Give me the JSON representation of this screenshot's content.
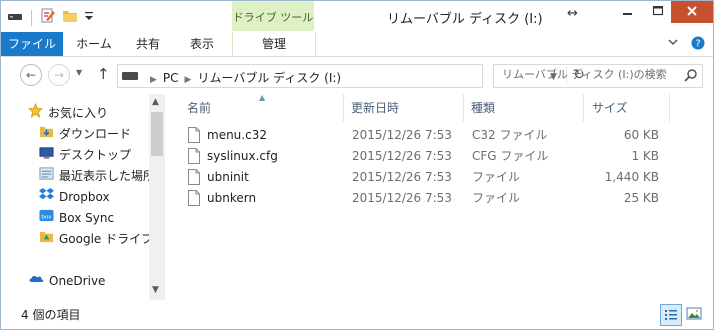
{
  "window": {
    "title": "リムーバブル ディスク (I:)",
    "context_tab": "ドライブ ツール"
  },
  "ribbon": {
    "tabs": [
      "ファイル",
      "ホーム",
      "共有",
      "表示",
      "管理"
    ]
  },
  "address": {
    "crumbs": [
      "PC",
      "リムーバブル ディスク (I:)"
    ]
  },
  "search": {
    "placeholder": "リムーバブル ディスク (I:)の検索"
  },
  "nav": {
    "items": [
      {
        "label": "お気に入り",
        "icon": "star-icon"
      },
      {
        "label": "ダウンロード",
        "icon": "download-folder-icon"
      },
      {
        "label": "デスクトップ",
        "icon": "desktop-icon"
      },
      {
        "label": "最近表示した場所",
        "icon": "recent-places-icon"
      },
      {
        "label": "Dropbox",
        "icon": "dropbox-icon"
      },
      {
        "label": "Box Sync",
        "icon": "box-sync-icon"
      },
      {
        "label": "Google ドライブ",
        "icon": "google-drive-icon"
      },
      {
        "label": "OneDrive",
        "icon": "onedrive-icon"
      }
    ]
  },
  "columns": {
    "name": "名前",
    "date": "更新日時",
    "type": "種類",
    "size": "サイズ"
  },
  "files": [
    {
      "name": "menu.c32",
      "date": "2015/12/26 7:53",
      "type": "C32 ファイル",
      "size": "60 KB"
    },
    {
      "name": "syslinux.cfg",
      "date": "2015/12/26 7:53",
      "type": "CFG ファイル",
      "size": "1 KB"
    },
    {
      "name": "ubninit",
      "date": "2015/12/26 7:53",
      "type": "ファイル",
      "size": "1,440 KB"
    },
    {
      "name": "ubnkern",
      "date": "2015/12/26 7:53",
      "type": "ファイル",
      "size": "25 KB"
    }
  ],
  "status": {
    "item_count": "4 個の項目"
  },
  "colors": {
    "file_tab": "#1979ca",
    "context_tab_bg": "#dff0c7",
    "close_button": "#c7502f",
    "header_text": "#4c607a"
  }
}
